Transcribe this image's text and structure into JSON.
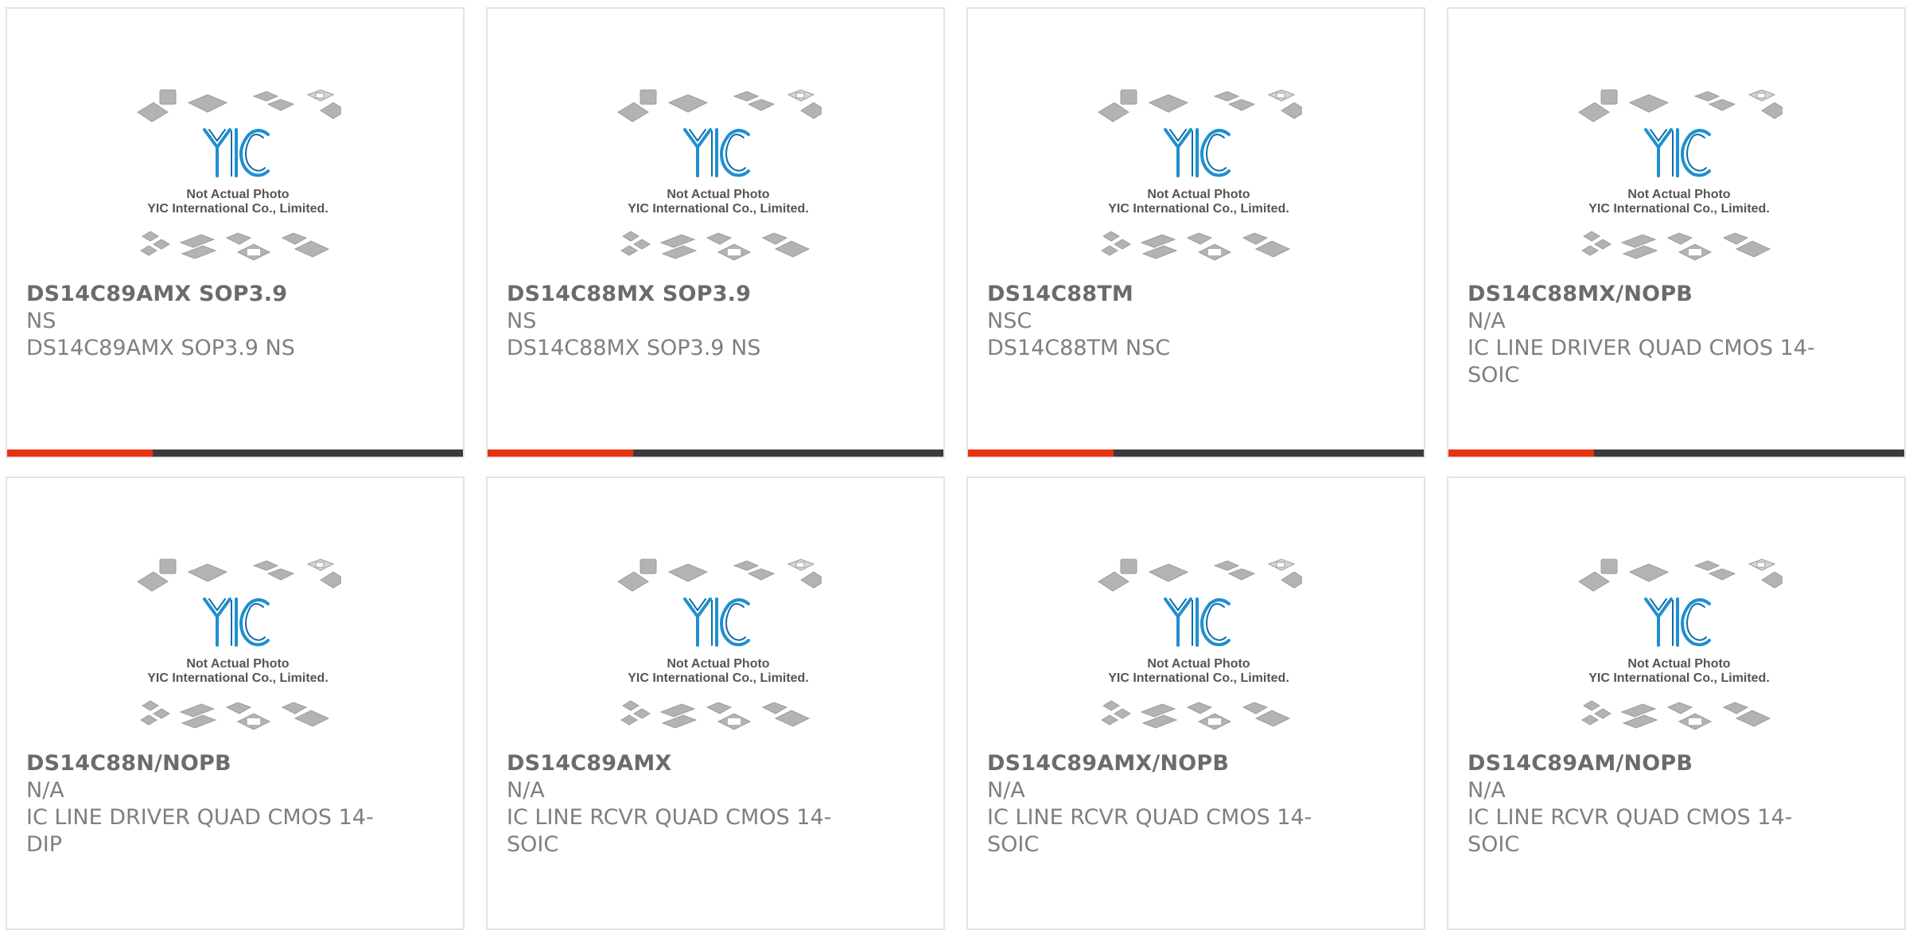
{
  "placeholder": {
    "line1": "Not Actual Photo",
    "line2": "YIC International Co., Limited.",
    "logo_text": "YIC",
    "logo_color": "#1e8fd0"
  },
  "colors": {
    "accent": "#e8320f",
    "bar": "#3b3b3b",
    "border": "#e3e3e3"
  },
  "products": [
    {
      "part": "DS14C89AMX SOP3.9",
      "mfr": "NS",
      "desc": "DS14C89AMX SOP3.9 NS"
    },
    {
      "part": "DS14C88MX SOP3.9",
      "mfr": "NS",
      "desc": "DS14C88MX SOP3.9 NS"
    },
    {
      "part": "DS14C88TM",
      "mfr": "NSC",
      "desc": "DS14C88TM NSC"
    },
    {
      "part": "DS14C88MX/NOPB",
      "mfr": "N/A",
      "desc": "IC LINE DRIVER QUAD CMOS 14-SOIC"
    },
    {
      "part": "DS14C88N/NOPB",
      "mfr": "N/A",
      "desc": "IC LINE DRIVER QUAD CMOS 14-DIP"
    },
    {
      "part": "DS14C89AMX",
      "mfr": "N/A",
      "desc": "IC LINE RCVR QUAD CMOS 14-SOIC"
    },
    {
      "part": "DS14C89AMX/NOPB",
      "mfr": "N/A",
      "desc": "IC LINE RCVR QUAD CMOS 14-SOIC"
    },
    {
      "part": "DS14C89AM/NOPB",
      "mfr": "N/A",
      "desc": "IC LINE RCVR QUAD CMOS 14-SOIC"
    }
  ]
}
